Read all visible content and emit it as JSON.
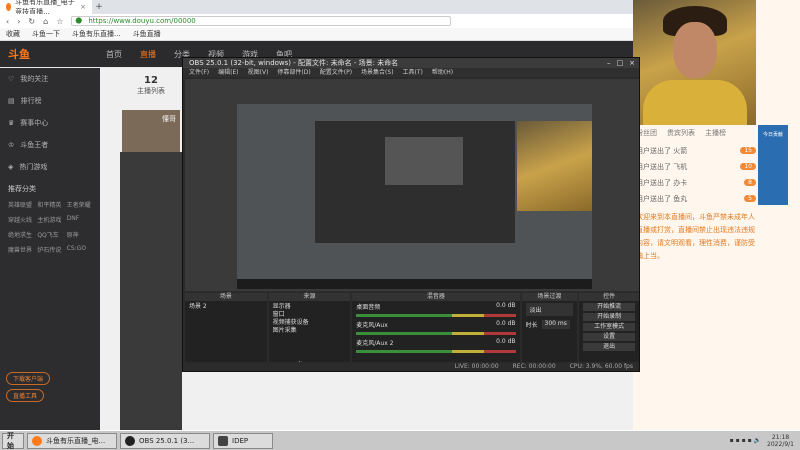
{
  "browser": {
    "tab_title": "斗鱼有乐直播_电子竞技直播...",
    "address": "https://www.douyu.com/00000",
    "bookmarks": [
      "收藏",
      "斗鱼一下",
      "斗鱼有乐直播...",
      "斗鱼直播"
    ]
  },
  "douyu": {
    "nav": [
      "首页",
      "直播",
      "分类",
      "视频",
      "游戏",
      "鱼吧"
    ],
    "sidebar_items": [
      "我的关注",
      "排行榜",
      "赛事中心",
      "斗鱼王者",
      "热门游戏"
    ],
    "sidebar_grid": [
      "英雄联盟",
      "和平精英",
      "王者荣耀",
      "穿越火线",
      "主机游戏",
      "DNF",
      "绝地求生",
      "QQ飞车",
      "原神",
      "魔兽世界",
      "炉石传说",
      "CS:GO"
    ],
    "sidebar_section": "推荐分类",
    "sidebar_pills": [
      "下载客户端",
      "直播工具"
    ],
    "anchor_count": "12",
    "anchor_label": "主播列表",
    "thumb_caption": "懂哥"
  },
  "chat": {
    "tabs": [
      "粉丝团",
      "贵宾列表",
      "主播榜"
    ],
    "gifts": [
      {
        "name": "用户送出了 火箭",
        "badge": "15"
      },
      {
        "name": "用户送出了 飞机",
        "badge": "10"
      },
      {
        "name": "用户送出了 办卡",
        "badge": "8"
      },
      {
        "name": "用户送出了 鱼丸",
        "badge": "5"
      }
    ],
    "message": "欢迎来到本直播间，斗鱼严禁未成年人直播或打赏，直播间禁止出现违法违规内容，请文明观看，理性消费，谨防受骗上当。",
    "side_badge": "今日贡献"
  },
  "obs": {
    "title": "OBS 25.0.1 (32-bit, windows) - 配置文件: 未命名 - 场景: 未命名",
    "menu": [
      "文件(F)",
      "编辑(E)",
      "视图(V)",
      "停靠部件(D)",
      "配置文件(P)",
      "场景集合(S)",
      "工具(T)",
      "帮助(H)"
    ],
    "docks": {
      "scenes": {
        "title": "场景",
        "items": [
          "场景 2"
        ]
      },
      "sources": {
        "title": "来源",
        "items": [
          "显示器",
          "窗口",
          "视频捕获设备",
          "图片采集"
        ]
      },
      "mixer": {
        "title": "混音器",
        "channels": [
          "桌面音频",
          "麦克风/Aux",
          "麦克风/Aux 2"
        ],
        "levels": [
          "0.0 dB",
          "0.0 dB",
          "0.0 dB"
        ]
      },
      "transitions": {
        "title": "场景过渡",
        "mode": "淡出",
        "duration_label": "时长",
        "duration": "300 ms"
      },
      "controls": {
        "title": "控件",
        "buttons": [
          "开始推流",
          "开始录制",
          "工作室模式",
          "设置",
          "退出"
        ]
      }
    },
    "status": [
      "LIVE: 00:00:00",
      "REC: 00:00:00",
      "CPU: 3.9%, 60.00 fps"
    ]
  },
  "taskbar": {
    "start": "开始",
    "tasks": [
      "斗鱼有乐直播_电...",
      "OBS 25.0.1 (3...",
      "IDEP"
    ],
    "time": "21:18",
    "date": "2022/9/1"
  }
}
